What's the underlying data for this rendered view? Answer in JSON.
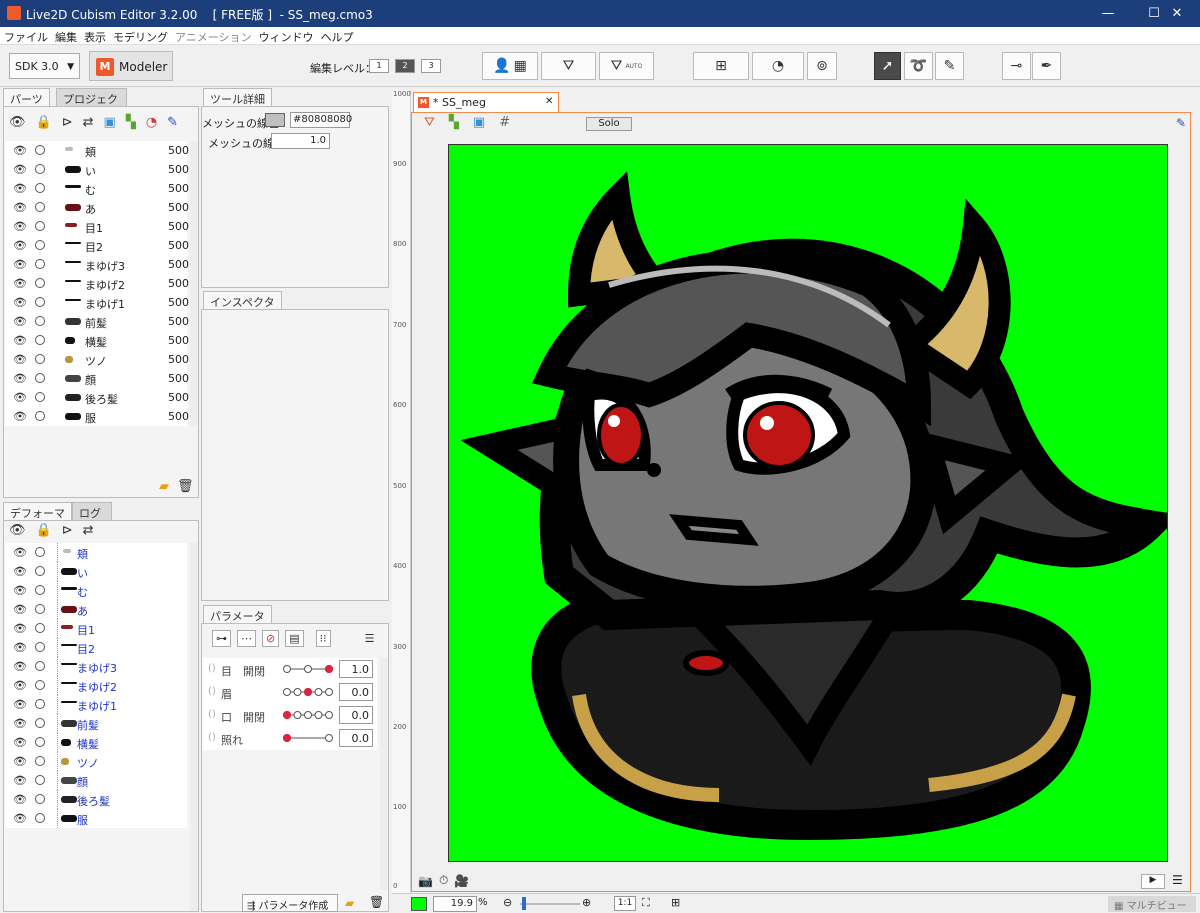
{
  "window": {
    "title": "Live2D Cubism Editor 3.2.00    [ FREE版 ]  - SS_meg.cmo3",
    "minimize": "—",
    "maximize": "☐",
    "close": "✕"
  },
  "menu": [
    "ファイル",
    "編集",
    "表示",
    "モデリング",
    "アニメーション",
    "ウィンドウ",
    "ヘルプ"
  ],
  "toolbar": {
    "sdk": "SDK 3.0",
    "modeler": "Modeler",
    "edit_level_label": "編集レベル：",
    "levels": [
      "1",
      "2",
      "3"
    ],
    "auto_label": "AUTO"
  },
  "parts_panel": {
    "tabs": [
      "パーツ",
      "プロジェクト"
    ],
    "items": [
      {
        "name": "頬",
        "value": "500"
      },
      {
        "name": "い",
        "value": "500"
      },
      {
        "name": "む",
        "value": "500"
      },
      {
        "name": "あ",
        "value": "500"
      },
      {
        "name": "目1",
        "value": "500"
      },
      {
        "name": "目2",
        "value": "500"
      },
      {
        "name": "まゆげ3",
        "value": "500"
      },
      {
        "name": "まゆげ2",
        "value": "500"
      },
      {
        "name": "まゆげ1",
        "value": "500"
      },
      {
        "name": "前髪",
        "value": "500"
      },
      {
        "name": "横髪",
        "value": "500"
      },
      {
        "name": "ツノ",
        "value": "500"
      },
      {
        "name": "顔",
        "value": "500"
      },
      {
        "name": "後ろ髪",
        "value": "500"
      },
      {
        "name": "服",
        "value": "500"
      }
    ]
  },
  "deformer_panel": {
    "tabs": [
      "デフォーマ",
      "ログ"
    ],
    "items": [
      "頬",
      "い",
      "む",
      "あ",
      "目1",
      "目2",
      "まゆげ3",
      "まゆげ2",
      "まゆげ1",
      "前髪",
      "横髪",
      "ツノ",
      "顔",
      "後ろ髪",
      "服"
    ]
  },
  "tool_details": {
    "tab": "ツール詳細",
    "mesh_color_label": "メッシュの線色",
    "mesh_color_value": "#80808080",
    "mesh_width_label": "メッシュの線幅",
    "mesh_width_value": "1.0"
  },
  "inspector": {
    "tab": "インスペクタ"
  },
  "parameters": {
    "tab": "パラメータ",
    "items": [
      {
        "name": "目　開閉",
        "value": "1.0",
        "level": 1.0,
        "keys": 3
      },
      {
        "name": "眉",
        "value": "0.0",
        "level": 0.5,
        "keys": 5
      },
      {
        "name": "口　開閉",
        "value": "0.0",
        "level": 0.0,
        "keys": 5
      },
      {
        "name": "照れ",
        "value": "0.0",
        "level": 0.0,
        "keys": 2
      }
    ],
    "create_button": "パラメータ作成"
  },
  "viewport": {
    "tab_label": "* SS_meg",
    "solo": "Solo",
    "background_color": "#00ff00",
    "ruler": [
      "1000",
      "900",
      "800",
      "700",
      "600",
      "500",
      "400",
      "300",
      "200",
      "100",
      "0"
    ]
  },
  "status": {
    "zoom": "19.9",
    "percent": "%",
    "ratio": "1:1",
    "multiview": "マルチビュー"
  }
}
